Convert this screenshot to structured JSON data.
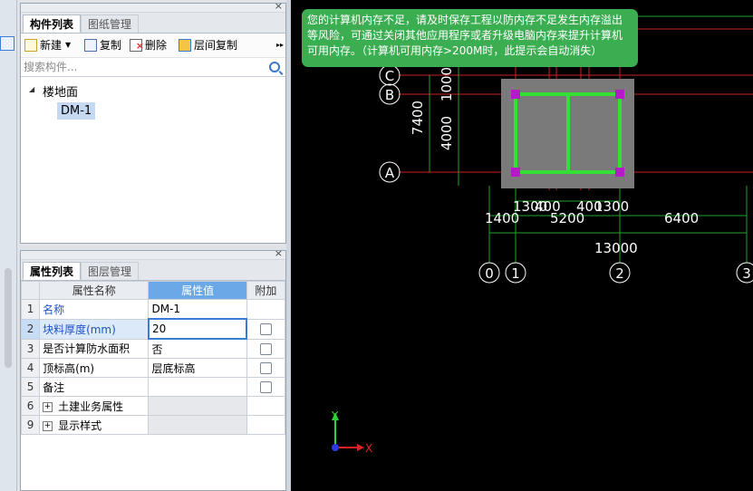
{
  "component_panel": {
    "tabs": [
      "构件列表",
      "图纸管理"
    ],
    "toolbar": {
      "new_label": "新建",
      "copy_label": "复制",
      "delete_label": "删除",
      "floor_copy_label": "层间复制"
    },
    "search_placeholder": "搜索构件...",
    "tree": {
      "root_label": "楼地面",
      "child_label": "DM-1"
    }
  },
  "property_panel": {
    "tabs": [
      "属性列表",
      "图层管理"
    ],
    "headers": {
      "name": "属性名称",
      "value": "属性值",
      "extra": "附加"
    },
    "rows": [
      {
        "num": "1",
        "name": "名称",
        "value": "DM-1"
      },
      {
        "num": "2",
        "name": "块料厚度(mm)",
        "value": "20"
      },
      {
        "num": "3",
        "name": "是否计算防水面积",
        "value": "否"
      },
      {
        "num": "4",
        "name": "顶标高(m)",
        "value": "层底标高"
      },
      {
        "num": "5",
        "name": "备注",
        "value": ""
      },
      {
        "num": "6",
        "name": "土建业务属性",
        "value": ""
      },
      {
        "num": "9",
        "name": "显示样式",
        "value": ""
      }
    ]
  },
  "canvas": {
    "notice_text": "您的计算机内存不足，请及时保存工程以防内存不足发生内存溢出等风险，可通过关闭其他应用程序或者升级电脑内存来提升计算机可用内存。（计算机可用内存>200M时，此提示会自动消失）",
    "axis_rows": [
      "C",
      "B",
      "A"
    ],
    "axis_cols": [
      "0",
      "1",
      "2",
      "3"
    ],
    "dims_vertical": [
      "7400",
      "1000",
      "4000"
    ],
    "dims_top": [
      "1300",
      "400",
      "400",
      "1300"
    ],
    "dims_middle": [
      "1400",
      "5200",
      "6400"
    ],
    "dims_total": "13000",
    "ucs": {
      "x": "X",
      "y": "Y"
    }
  }
}
